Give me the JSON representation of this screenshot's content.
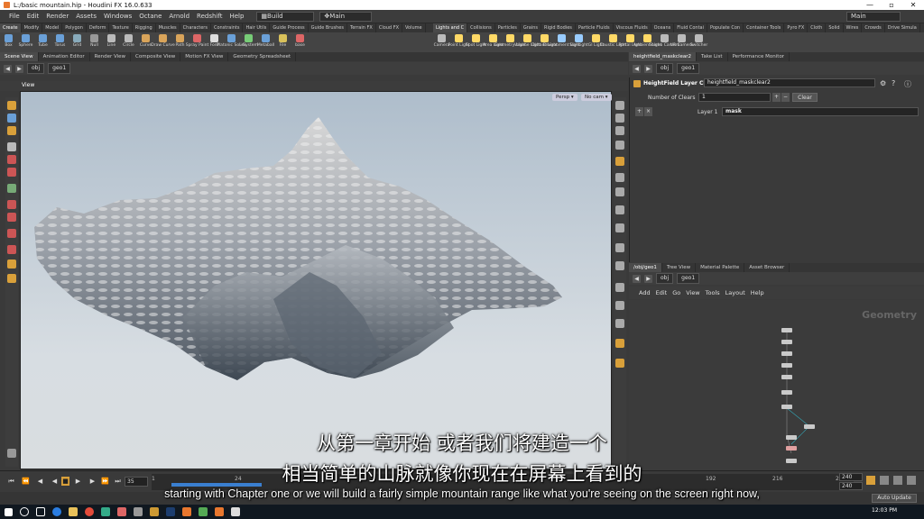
{
  "window": {
    "title": "L:/basic mountain.hip - Houdini FX 16.0.633"
  },
  "menu": {
    "items": [
      "File",
      "Edit",
      "Render",
      "Assets",
      "Windows",
      "Octane",
      "Arnold",
      "Redshift",
      "Help"
    ],
    "desktop": "Build",
    "main": "Main",
    "main_right": "Main"
  },
  "shelf_tabs_left": [
    "Create",
    "Modify",
    "Model",
    "Polygon",
    "Deform",
    "Texture",
    "Rigging",
    "Muscles",
    "Characters",
    "Constraints",
    "Hair Utils",
    "Guide Process",
    "Guide Brushes",
    "Terrain FX",
    "Cloud FX",
    "Volume"
  ],
  "shelf_tabs_right": [
    "Lights and C",
    "Collisions",
    "Particles",
    "Grains",
    "Rigid Bodies",
    "Particle Fluids",
    "Viscous Fluids",
    "Oceans",
    "Fluid Contai",
    "Populate Con",
    "Container Tools",
    "Pyro FX",
    "Cloth",
    "Solid",
    "Wires",
    "Crowds",
    "Drive Simula"
  ],
  "shelf_tools_left": [
    {
      "label": "Box",
      "color": "#6aa0d8"
    },
    {
      "label": "Sphere",
      "color": "#6aa0d8"
    },
    {
      "label": "Tube",
      "color": "#6aa0d8"
    },
    {
      "label": "Torus",
      "color": "#6aa0d8"
    },
    {
      "label": "Grid",
      "color": "#8ab"
    },
    {
      "label": "Null",
      "color": "#999"
    },
    {
      "label": "Line",
      "color": "#bbb"
    },
    {
      "label": "Circle",
      "color": "#bbb"
    },
    {
      "label": "Curve",
      "color": "#d9a45a"
    },
    {
      "label": "Draw Curve",
      "color": "#d9a45a"
    },
    {
      "label": "Path",
      "color": "#d9a45a"
    },
    {
      "label": "Spray Paint",
      "color": "#d66"
    },
    {
      "label": "Font",
      "color": "#ddd"
    },
    {
      "label": "Platonic Solids",
      "color": "#6aa0d8"
    },
    {
      "label": "L-System",
      "color": "#7c7"
    },
    {
      "label": "Metaball",
      "color": "#6aa0d8"
    },
    {
      "label": "File",
      "color": "#d9c15a"
    },
    {
      "label": "base",
      "color": "#d66"
    }
  ],
  "shelf_tools_right": [
    {
      "label": "Camera",
      "color": "#bbb"
    },
    {
      "label": "Point Light",
      "color": "#ffd966"
    },
    {
      "label": "Spot Light",
      "color": "#ffd966"
    },
    {
      "label": "Area Light",
      "color": "#ffd966"
    },
    {
      "label": "Geometry Light",
      "color": "#ffd966"
    },
    {
      "label": "Volume Light",
      "color": "#ffd966"
    },
    {
      "label": "Distant Light",
      "color": "#ffd966"
    },
    {
      "label": "Environment Light",
      "color": "#9cf"
    },
    {
      "label": "Sky Light",
      "color": "#9cf"
    },
    {
      "label": "GI Light",
      "color": "#ffd966"
    },
    {
      "label": "Caustic Light",
      "color": "#ffd966"
    },
    {
      "label": "Portal Light",
      "color": "#ffd966"
    },
    {
      "label": "Ambient Light",
      "color": "#ffd966"
    },
    {
      "label": "Stereo Camera",
      "color": "#bbb"
    },
    {
      "label": "VR Camera",
      "color": "#bbb"
    },
    {
      "label": "Switcher",
      "color": "#bbb"
    }
  ],
  "left_tabs": [
    "Scene View",
    "Animation Editor",
    "Render View",
    "Composite View",
    "Motion FX View",
    "Geometry Spreadsheet"
  ],
  "right_tabs": [
    "heightfield_maskclear2",
    "Take List",
    "Performance Monitor"
  ],
  "left_path": {
    "obj": "obj",
    "geo": "geo1"
  },
  "right_path": {
    "obj": "obj",
    "geo": "geo1"
  },
  "viewport": {
    "label": "View",
    "persp": "Persp ▾",
    "nocam": "No cam ▾"
  },
  "params": {
    "node_type": "HeightField Layer Clear",
    "node_name": "heightfield_maskclear2",
    "clears_label": "Number of Clears",
    "clears_value": "1",
    "clear_button": "Clear",
    "layer_label": "Layer 1",
    "layer_value": "mask"
  },
  "net_tabs": [
    "/obj/geo1",
    "Tree View",
    "Material Palette",
    "Asset Browser"
  ],
  "net_path": {
    "obj": "obj",
    "geo": "geo1"
  },
  "net_menu": [
    "Add",
    "Edit",
    "Go",
    "View",
    "Tools",
    "Layout",
    "Help"
  ],
  "network": {
    "context_label": "Geometry"
  },
  "timeline": {
    "frame": "35",
    "start": "1",
    "ticks": [
      "1",
      "24",
      "192",
      "216",
      "24"
    ],
    "end1": "240",
    "end2": "240",
    "auto_update": "Auto Update"
  },
  "subtitles": {
    "zh_line1": "从第一章开始 或者我们将建造一个",
    "zh_line2": "相当简单的山脉就像你现在在屏幕上看到的",
    "en_line": "starting with Chapter one or we will build a fairly simple mountain range like what you're seeing on the screen right now,"
  },
  "taskbar": {
    "time": "12:03 PM"
  }
}
